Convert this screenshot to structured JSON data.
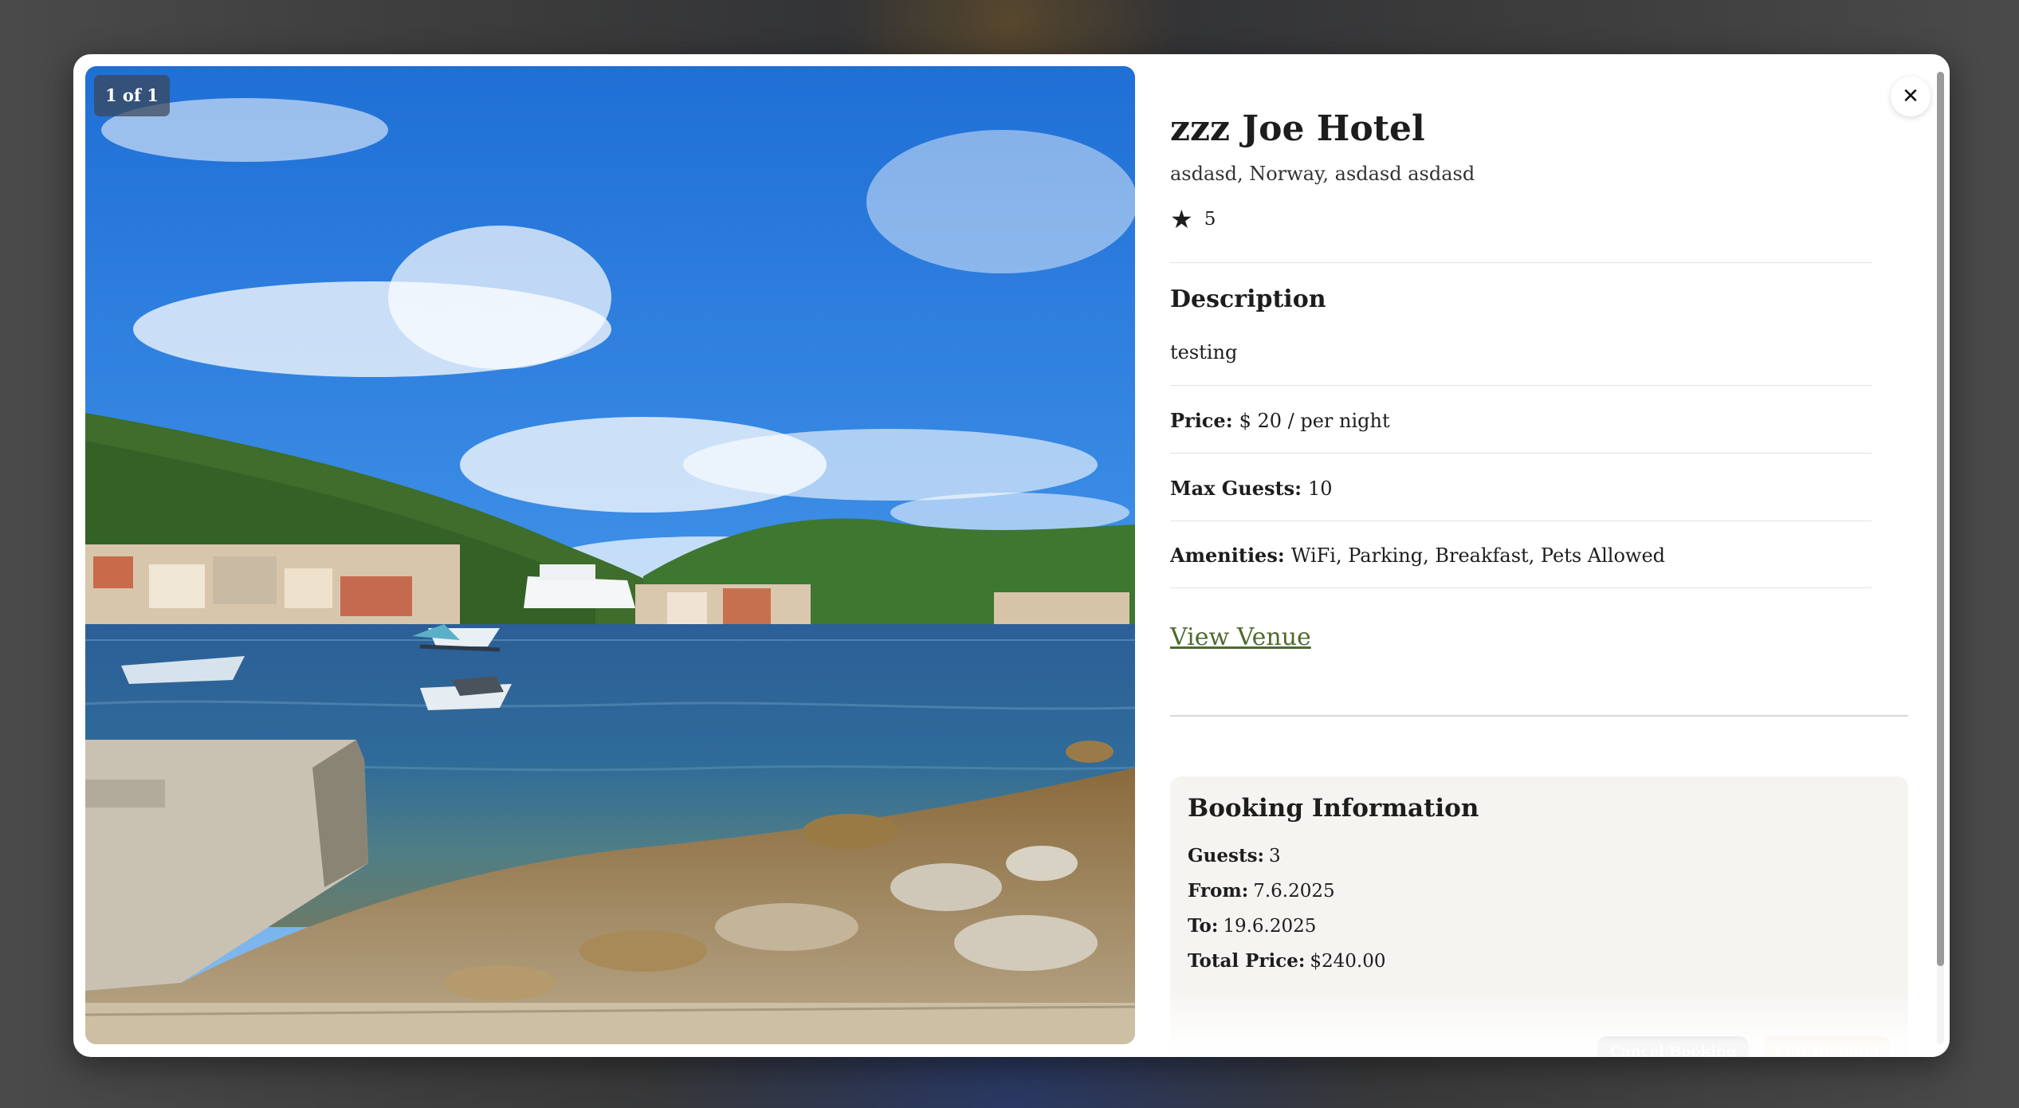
{
  "gallery": {
    "counter": "1 of 1"
  },
  "close": {
    "label": "✕"
  },
  "venue": {
    "name": "zzz Joe Hotel",
    "location": "asdasd, Norway, asdasd asdasd",
    "rating_icon": "★",
    "rating": "5"
  },
  "description": {
    "heading": "Description",
    "text": "testing"
  },
  "details": {
    "price_label": "Price:",
    "price_value": "$ 20 / per night",
    "guests_label": "Max Guests:",
    "guests_value": "10",
    "amenities_label": "Amenities:",
    "amenities_value": "WiFi, Parking, Breakfast, Pets Allowed"
  },
  "view_venue": "View Venue",
  "booking": {
    "heading": "Booking Information",
    "guests_label": "Guests:",
    "guests_value": "3",
    "from_label": "From:",
    "from_value": "7.6.2025",
    "to_label": "To:",
    "to_value": "19.6.2025",
    "total_label": "Total Price:",
    "total_value": "$240.00",
    "cancel_button": "Cancel Booking",
    "edit_button": "Edit Booking"
  },
  "colors": {
    "link": "#4f6a2f",
    "booking_bg": "#f6f4f0",
    "cancel_btn": "#9f9f9f",
    "edit_btn": "#e4d3b6"
  }
}
